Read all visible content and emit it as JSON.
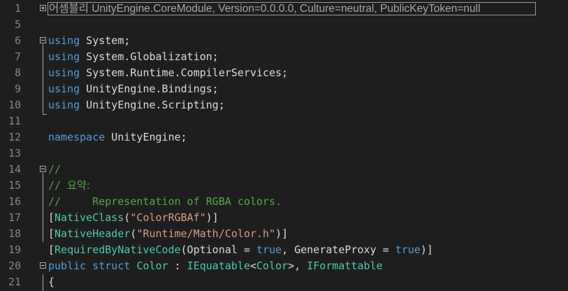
{
  "editor": {
    "line_numbers": [
      "1",
      "5",
      "6",
      "7",
      "8",
      "9",
      "10",
      "11",
      "12",
      "13",
      "14",
      "15",
      "16",
      "17",
      "18",
      "19",
      "20",
      "21"
    ],
    "lines": {
      "l1": {
        "assembly_label": "어셈블리",
        "assembly_info": " UnityEngine.CoreModule, Version=0.0.0.0, Culture=neutral, PublicKeyToken=null"
      },
      "l6": {
        "kw": "using",
        "rest": " System;"
      },
      "l7": {
        "kw": "using",
        "rest": " System.Globalization;"
      },
      "l8": {
        "kw": "using",
        "rest": " System.Runtime.CompilerServices;"
      },
      "l9": {
        "kw": "using",
        "rest": " UnityEngine.Bindings;"
      },
      "l10": {
        "kw": "using",
        "rest": " UnityEngine.Scripting;"
      },
      "l12": {
        "kw": "namespace",
        "rest": " UnityEngine;"
      },
      "l14": {
        "comment": "//"
      },
      "l15": {
        "comment_prefix": "// ",
        "comment_text": "요약:"
      },
      "l16": {
        "comment": "//     Representation of RGBA colors."
      },
      "l17": {
        "open": "[",
        "attr": "NativeClass",
        "p1": "(",
        "str": "\"ColorRGBAf\"",
        "close": ")]"
      },
      "l18": {
        "open": "[",
        "attr": "NativeHeader",
        "p1": "(",
        "str": "\"Runtime/Math/Color.h\"",
        "close": ")]"
      },
      "l19": {
        "open": "[",
        "attr": "RequiredByNativeCode",
        "p1": "(Optional = ",
        "v1": "true",
        "p2": ", GenerateProxy = ",
        "v2": "true",
        "close": ")]"
      },
      "l20": {
        "k1": "public",
        "k2": "struct",
        "name": "Color",
        "colon": " : ",
        "iface1": "IEquatable",
        "lt": "<",
        "targ": "Color",
        "gt": ">",
        "comma": ", ",
        "iface2": "IFormattable"
      },
      "l21": {
        "brace": "{"
      }
    }
  },
  "colors": {
    "background": "#1e1e1e",
    "keyword": "#569cd6",
    "type": "#4ec9b0",
    "string": "#d69d85",
    "comment": "#57a64a",
    "text": "#dcdcdc",
    "line_number": "#858585"
  }
}
